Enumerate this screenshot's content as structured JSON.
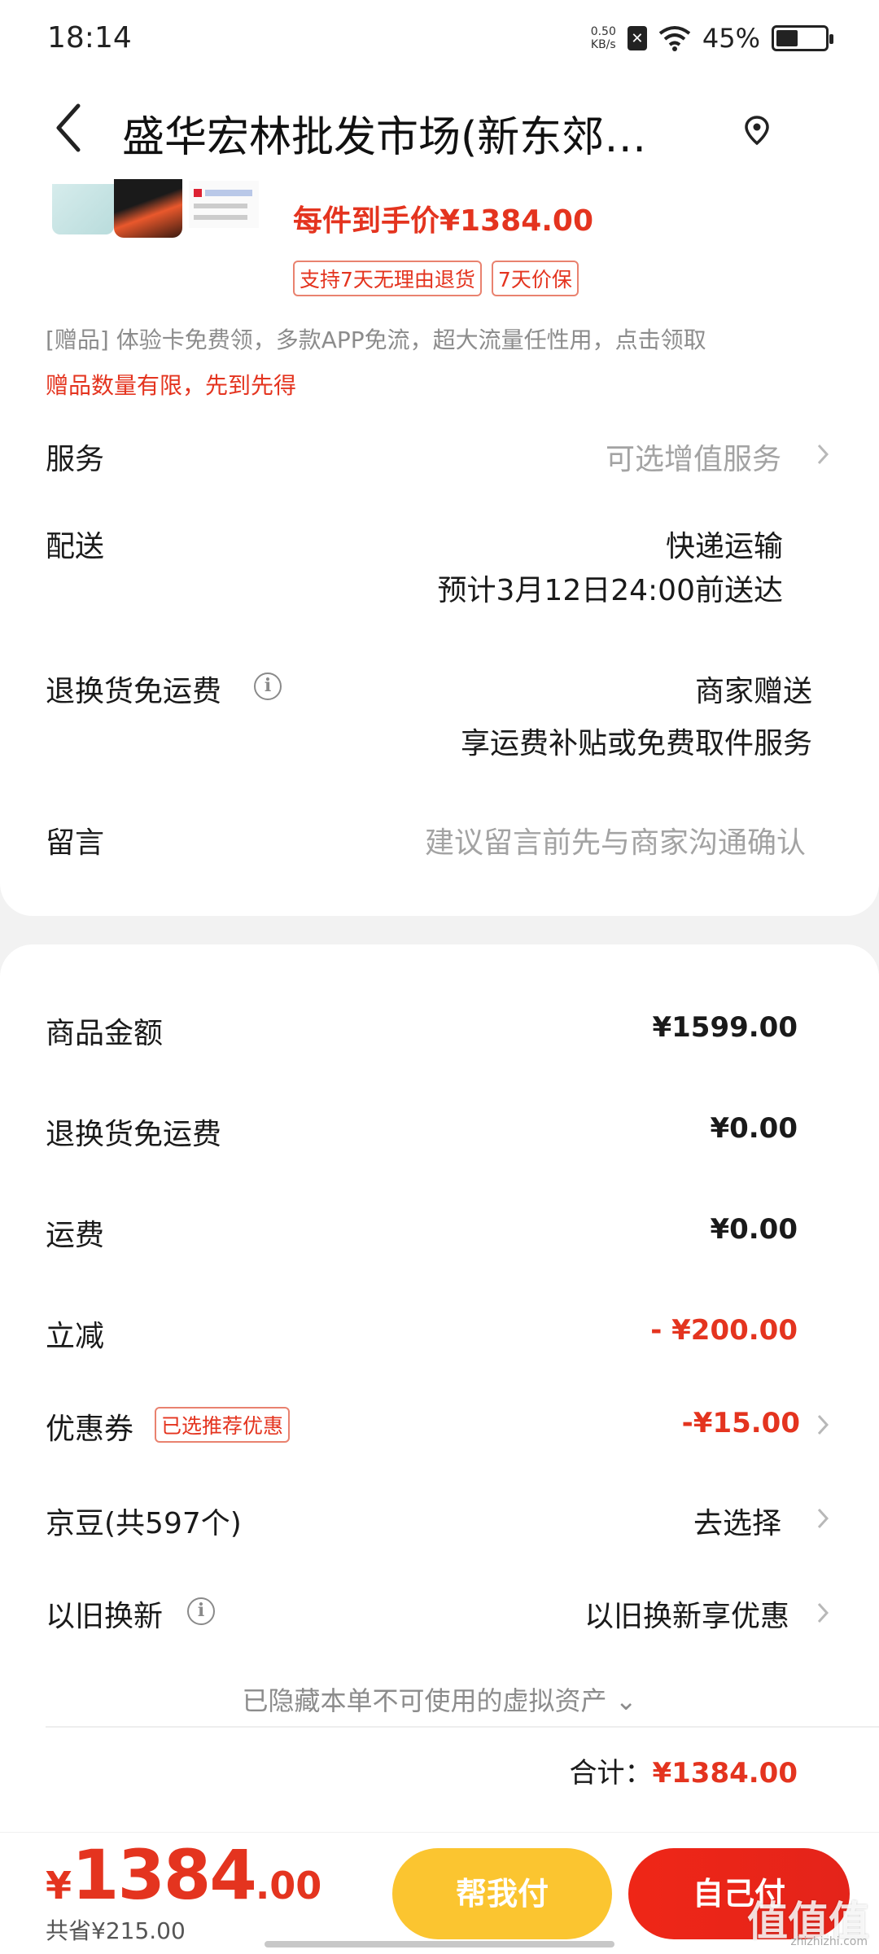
{
  "status_bar": {
    "time": "18:14",
    "net_speed_value": "0.50",
    "net_speed_unit": "KB/s",
    "battery_percent": "45%",
    "battery_level": 0.45
  },
  "header": {
    "title": "盛华宏林批发市场(新东郊…"
  },
  "product": {
    "per_price": "每件到手价¥1384.00",
    "tags": [
      "支持7天无理由退货",
      "7天价保"
    ]
  },
  "gift": {
    "text": "[赠品]   体验卡免费领，多款APP免流，超大流量任性用，点击领取",
    "note": "赠品数量有限，先到先得"
  },
  "service": {
    "label": "服务",
    "value": "可选增值服务"
  },
  "delivery": {
    "label": "配送",
    "method": "快递运输",
    "eta": "预计3月12日24:00前送达"
  },
  "return_shipping": {
    "label": "退换货免运费",
    "value": "商家赠送",
    "desc": "享运费补贴或免费取件服务"
  },
  "message": {
    "label": "留言",
    "placeholder": "建议留言前先与商家沟通确认"
  },
  "summary": {
    "goods_amount_label": "商品金额",
    "goods_amount": "¥1599.00",
    "return_free_label": "退换货免运费",
    "return_free": "¥0.00",
    "shipping_label": "运费",
    "shipping": "¥0.00",
    "discount_label": "立减",
    "discount": "- ¥200.00",
    "coupon_label": "优惠券",
    "coupon_tag": "已选推荐优惠",
    "coupon": "-¥15.00",
    "jd_beans_label": "京豆(共597个)",
    "jd_beans_value": "去选择",
    "tradein_label": "以旧换新",
    "tradein_value": "以旧换新享优惠",
    "hidden_assets": "已隐藏本单不可使用的虚拟资产",
    "total_label": "合计：",
    "total": "¥1384.00"
  },
  "bottom": {
    "currency": "¥",
    "price_int": "1384",
    "price_dec": ".00",
    "saved": "共省¥215.00",
    "help_pay": "帮我付",
    "self_pay": "自己付"
  },
  "watermark": {
    "text": "值值值",
    "sub": "zhizhizhi.com"
  },
  "colors": {
    "accent_red": "#e4341f",
    "help_yellow": "#fbc530"
  }
}
